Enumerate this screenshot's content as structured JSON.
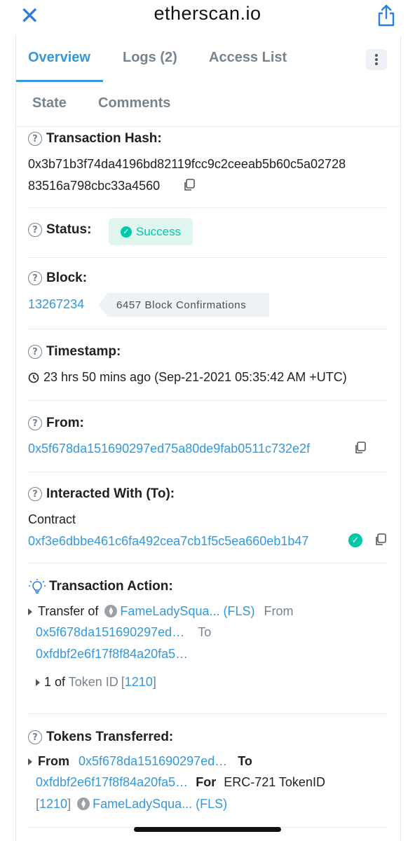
{
  "browser": {
    "url": "etherscan.io"
  },
  "tabs": [
    "Overview",
    "Logs (2)",
    "Access List",
    "State",
    "Comments"
  ],
  "tx": {
    "hash_label": "Transaction Hash:",
    "hash_line1": "0x3b71b3f74da4196bd82119fcc9c2ceeab5b60c5a02728",
    "hash_line2": "83516a798cbc33a4560",
    "status_label": "Status:",
    "status_value": "Success",
    "block_label": "Block:",
    "block_number": "13267234",
    "block_confirmations": "6457 Block Confirmations",
    "timestamp_label": "Timestamp:",
    "timestamp_value": "23 hrs 50 mins ago (Sep-21-2021 05:35:42 AM +UTC)",
    "from_label": "From:",
    "from_address": "0x5f678da151690297ed75a80de9fab0511c732e2f",
    "to_label": "Interacted With (To):",
    "to_prefix": "Contract",
    "to_address": "0xf3e6dbbe461c6fa492cea7cb1f5c5ea660eb1b47"
  },
  "action": {
    "label": "Transaction Action:",
    "transfer_of": "Transfer of",
    "token_name": "FameLadySqua... (FLS)",
    "from_word": "From",
    "from_addr": "0x5f678da151690297ed…",
    "to_word": "To",
    "to_addr": "0xfdbf2e6f17f8f84a20fa5…",
    "count_prefix": "1 of",
    "token_id_label": "Token ID",
    "token_id_open": "[",
    "token_id": "1210",
    "token_id_close": "]"
  },
  "transferred": {
    "label": "Tokens Transferred:",
    "from_word": "From",
    "from_addr": "0x5f678da151690297ed…",
    "to_word": "To",
    "to_addr": "0xfdbf2e6f17f8f84a20fa5…",
    "for_word": "For",
    "standard": "ERC-721 TokenID",
    "token_id_open": "[",
    "token_id": "1210",
    "token_id_close": "]",
    "token_name": "FameLadySqua... (FLS)"
  },
  "colors": {
    "accent": "#3498db",
    "success": "#00c9a7",
    "muted": "#77838f"
  }
}
